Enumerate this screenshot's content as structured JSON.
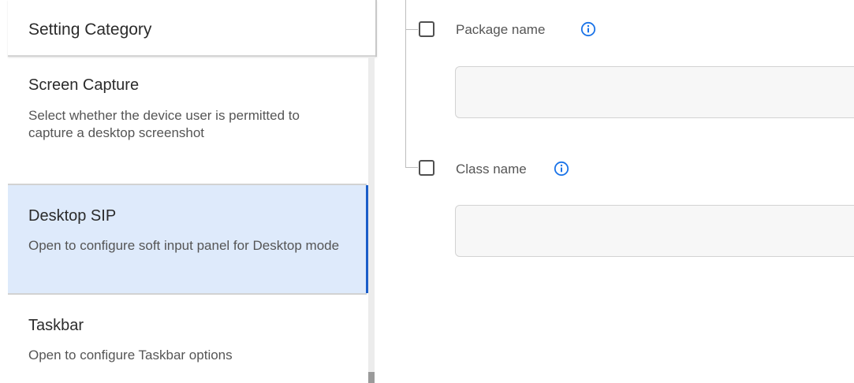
{
  "left_panel": {
    "header": "Setting Category",
    "items": [
      {
        "title": "Screen Capture",
        "description": "Select whether the device user is permitted to capture a desktop screenshot",
        "selected": false
      },
      {
        "title": "Desktop SIP",
        "description": "Open to configure soft input panel for Desktop mode",
        "selected": true
      },
      {
        "title": "Taskbar",
        "description": "Open to configure Taskbar options",
        "selected": false
      }
    ]
  },
  "right_panel": {
    "fields": [
      {
        "label": "Package name",
        "checked": false,
        "value": "",
        "placeholder": "",
        "icon": "info-icon"
      },
      {
        "label": "Class name",
        "checked": false,
        "value": "",
        "placeholder": "",
        "icon": "info-icon"
      }
    ]
  },
  "colors": {
    "accent": "#1a5dc9",
    "selected_bg": "#deeafb",
    "info_icon": "#1a73e8"
  }
}
